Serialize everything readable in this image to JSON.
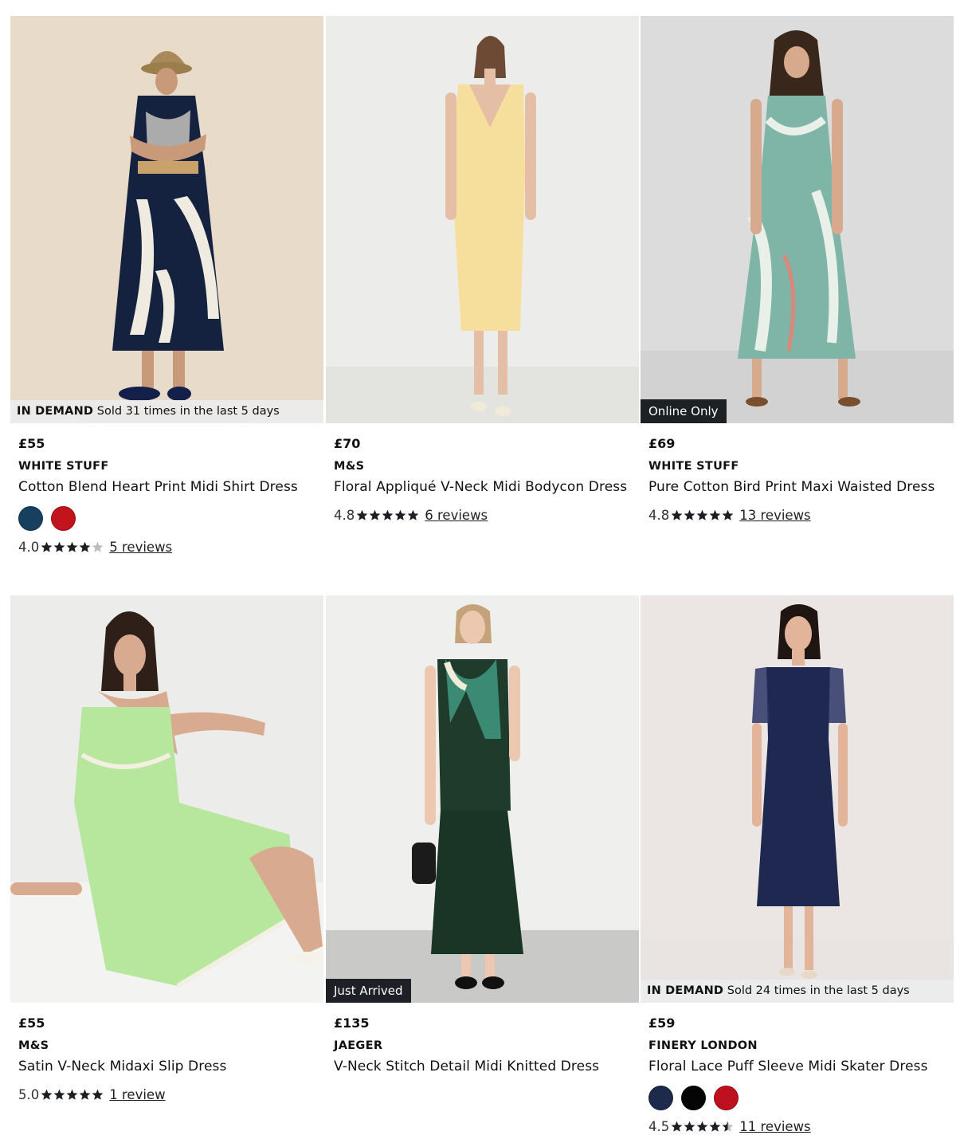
{
  "colors": {
    "star_filled": "#1b1f24",
    "star_empty": "#bdbdbd",
    "badge_dark_bg": "#1d2024",
    "badge_light_bg": "#ececec"
  },
  "products": [
    {
      "price": "£55",
      "brand": "WHITE STUFF",
      "title": "Cotton Blend Heart Print Midi Shirt Dress",
      "badge": {
        "type": "demand",
        "strong": "IN DEMAND",
        "text": "Sold 31 times in the last 5 days"
      },
      "swatches": [
        {
          "name": "navy",
          "color": "#16405e"
        },
        {
          "name": "red",
          "color": "#c3141e"
        }
      ],
      "rating": {
        "score": "4.0",
        "stars": 4.0,
        "reviews": "5 reviews"
      }
    },
    {
      "price": "£70",
      "brand": "M&S",
      "title": "Floral Appliqué V-Neck Midi Bodycon Dress",
      "badge": null,
      "swatches": [],
      "rating": {
        "score": "4.8",
        "stars": 5,
        "reviews": "6 reviews"
      }
    },
    {
      "price": "£69",
      "brand": "WHITE STUFF",
      "title": "Pure Cotton Bird Print Maxi Waisted Dress",
      "badge": {
        "type": "label",
        "text": "Online Only"
      },
      "swatches": [],
      "rating": {
        "score": "4.8",
        "stars": 5,
        "reviews": "13 reviews"
      }
    },
    {
      "price": "£55",
      "brand": "M&S",
      "title": "Satin V-Neck Midaxi Slip Dress",
      "badge": null,
      "swatches": [],
      "rating": {
        "score": "5.0",
        "stars": 5,
        "reviews": "1 review"
      }
    },
    {
      "price": "£135",
      "brand": "JAEGER",
      "title": "V-Neck Stitch Detail Midi Knitted Dress",
      "badge": {
        "type": "label",
        "text": "Just Arrived"
      },
      "swatches": [],
      "rating": null
    },
    {
      "price": "£59",
      "brand": "FINERY LONDON",
      "title": "Floral Lace Puff Sleeve Midi Skater Dress",
      "badge": {
        "type": "demand",
        "strong": "IN DEMAND",
        "text": "Sold 24 times in the last 5 days"
      },
      "swatches": [
        {
          "name": "navy",
          "color": "#1e2a4c"
        },
        {
          "name": "black",
          "color": "#050505"
        },
        {
          "name": "red",
          "color": "#bf1020"
        }
      ],
      "rating": {
        "score": "4.5",
        "stars": 4.5,
        "reviews": "11 reviews"
      }
    }
  ]
}
